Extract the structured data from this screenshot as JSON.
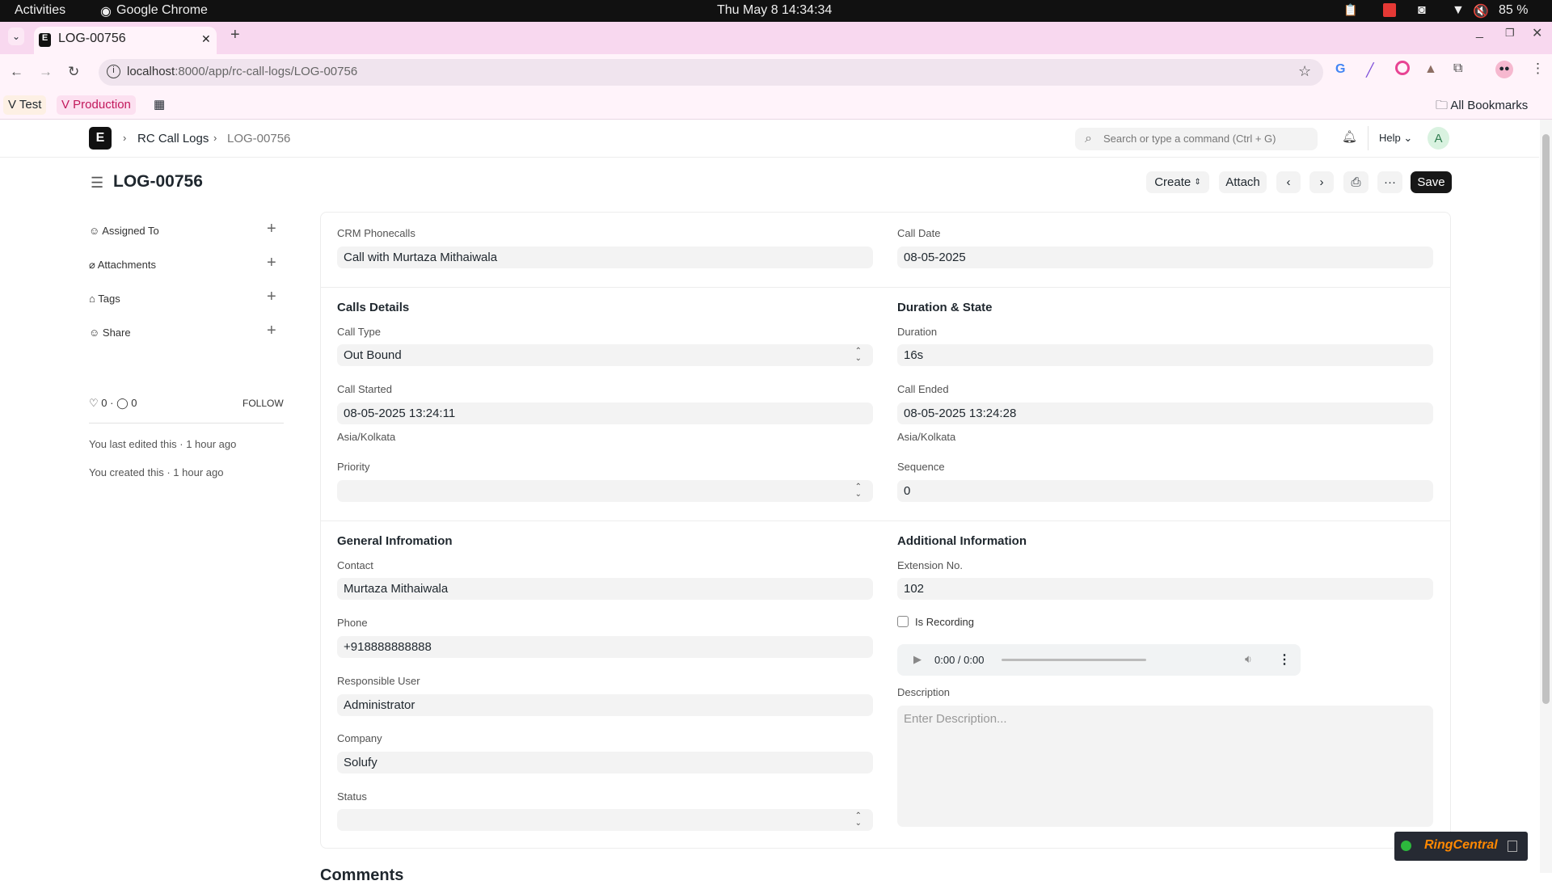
{
  "os": {
    "activities": "Activities",
    "app": "Google Chrome",
    "clock": "Thu May 8  14:34:34",
    "battery": "85 %"
  },
  "browser": {
    "tab_title": "LOG-00756",
    "url_host": "localhost",
    "url_rest": ":8000/app/rc-call-logs/LOG-00756",
    "bookmarks": [
      "V Test",
      "V Production"
    ],
    "all_bookmarks": "All Bookmarks"
  },
  "app": {
    "logo": "E",
    "breadcrumb": [
      "RC Call Logs",
      "LOG-00756"
    ],
    "search_placeholder": "Search or type a command (Ctrl + G)",
    "help": "Help",
    "avatar": "A"
  },
  "page": {
    "title": "LOG-00756",
    "buttons": {
      "create": "Create",
      "attach": "Attach",
      "save": "Save"
    }
  },
  "sidebar": {
    "items": [
      "Assigned To",
      "Attachments",
      "Tags",
      "Share"
    ],
    "likes": "0",
    "comments": "0",
    "follow": "FOLLOW",
    "activity": [
      "You last edited this · 1 hour ago",
      "You created this · 1 hour ago"
    ]
  },
  "form": {
    "crm_phonecalls": {
      "label": "CRM Phonecalls",
      "value": "Call with Murtaza Mithaiwala"
    },
    "call_date": {
      "label": "Call Date",
      "value": "08-05-2025"
    },
    "calls_details": "Calls Details",
    "duration_state": "Duration & State",
    "call_type": {
      "label": "Call Type",
      "value": "Out Bound"
    },
    "duration": {
      "label": "Duration",
      "value": "16s"
    },
    "call_started": {
      "label": "Call Started",
      "value": "08-05-2025 13:24:11",
      "tz": "Asia/Kolkata"
    },
    "call_ended": {
      "label": "Call Ended",
      "value": "08-05-2025 13:24:28",
      "tz": "Asia/Kolkata"
    },
    "priority": {
      "label": "Priority",
      "value": ""
    },
    "sequence": {
      "label": "Sequence",
      "value": "0"
    },
    "general_info": "General Infromation",
    "additional_info": "Additional Information",
    "contact": {
      "label": "Contact",
      "value": "Murtaza Mithaiwala"
    },
    "extension": {
      "label": "Extension No.",
      "value": "102"
    },
    "phone": {
      "label": "Phone",
      "value": "+918888888888"
    },
    "is_recording": {
      "label": "Is Recording",
      "checked": false
    },
    "audio_time": "0:00 / 0:00",
    "responsible_user": {
      "label": "Responsible User",
      "value": "Administrator"
    },
    "description": {
      "label": "Description",
      "placeholder": "Enter Description..."
    },
    "company": {
      "label": "Company",
      "value": "Solufy"
    },
    "status": {
      "label": "Status",
      "value": ""
    }
  },
  "comments_heading": "Comments",
  "ringcentral": "RingCentral"
}
